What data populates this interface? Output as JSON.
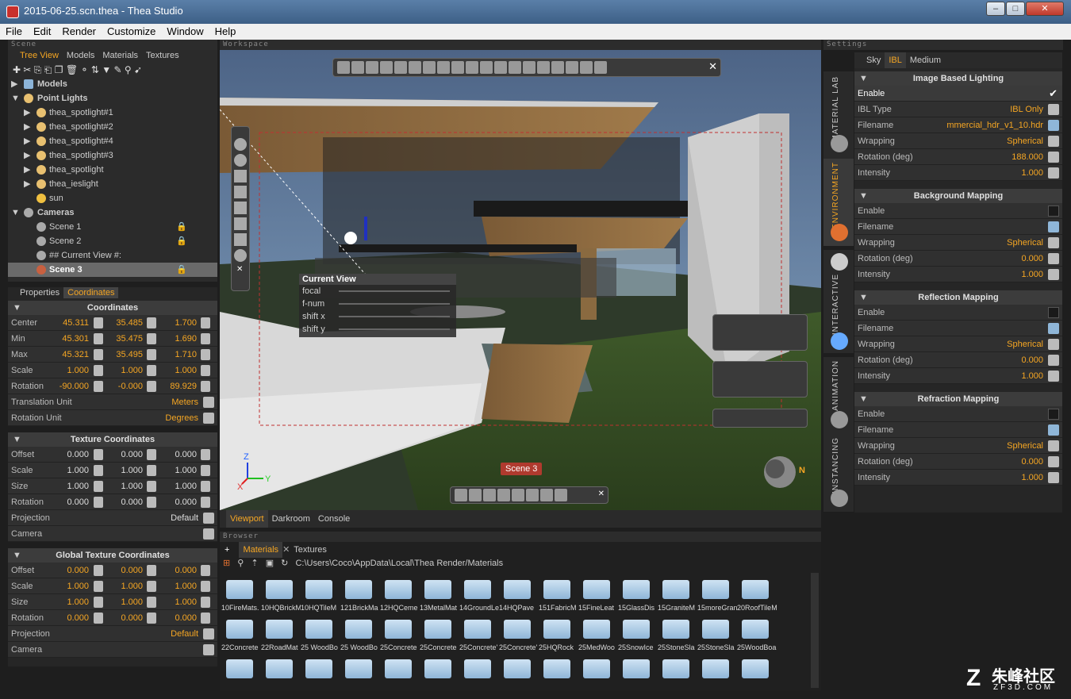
{
  "window": {
    "title": "2015-06-25.scn.thea - Thea Studio",
    "min": "–",
    "max": "□",
    "close": "✕"
  },
  "menu": [
    "File",
    "Edit",
    "Render",
    "Customize",
    "Window",
    "Help"
  ],
  "scene_panel": {
    "header": "Scene",
    "tabs": [
      "Tree View",
      "Models",
      "Materials",
      "Textures"
    ],
    "tree": {
      "models": "Models",
      "point_lights": "Point Lights",
      "lights": [
        "thea_spotlight#1",
        "thea_spotlight#2",
        "thea_spotlight#4",
        "thea_spotlight#3",
        "thea_spotlight",
        "thea_ieslight",
        "sun"
      ],
      "cameras": "Cameras",
      "camera_items": [
        "Scene 1",
        "Scene 2",
        "## Current View #:",
        "Scene 3"
      ]
    }
  },
  "props_panel": {
    "tabs": [
      "Properties",
      "Coordinates"
    ],
    "coords": {
      "title": "Coordinates",
      "rows": [
        {
          "label": "Center",
          "v": [
            "45.311",
            "35.485",
            "1.700"
          ]
        },
        {
          "label": "Min",
          "v": [
            "45.301",
            "35.475",
            "1.690"
          ]
        },
        {
          "label": "Max",
          "v": [
            "45.321",
            "35.495",
            "1.710"
          ]
        },
        {
          "label": "Scale",
          "v": [
            "1.000",
            "1.000",
            "1.000"
          ]
        },
        {
          "label": "Rotation",
          "v": [
            "-90.000",
            "-0.000",
            "89.929"
          ]
        }
      ],
      "translation_unit": {
        "label": "Translation Unit",
        "value": "Meters"
      },
      "rotation_unit": {
        "label": "Rotation Unit",
        "value": "Degrees"
      }
    },
    "texcoords": {
      "title": "Texture Coordinates",
      "rows": [
        {
          "label": "Offset",
          "v": [
            "0.000",
            "0.000",
            "0.000"
          ]
        },
        {
          "label": "Scale",
          "v": [
            "1.000",
            "1.000",
            "1.000"
          ]
        },
        {
          "label": "Size",
          "v": [
            "1.000",
            "1.000",
            "1.000"
          ]
        },
        {
          "label": "Rotation",
          "v": [
            "0.000",
            "0.000",
            "0.000"
          ]
        }
      ],
      "projection": {
        "label": "Projection",
        "value": "Default"
      },
      "camera": "Camera"
    },
    "global": {
      "title": "Global Texture Coordinates",
      "rows": [
        {
          "label": "Offset",
          "v": [
            "0.000",
            "0.000",
            "0.000"
          ]
        },
        {
          "label": "Scale",
          "v": [
            "1.000",
            "1.000",
            "1.000"
          ]
        },
        {
          "label": "Size",
          "v": [
            "1.000",
            "1.000",
            "1.000"
          ]
        },
        {
          "label": "Rotation",
          "v": [
            "0.000",
            "0.000",
            "0.000"
          ]
        }
      ],
      "projection": {
        "label": "Projection",
        "value": "Default"
      },
      "camera": "Camera"
    }
  },
  "workspace": {
    "header": "Workspace",
    "current_view": {
      "title": "Current View",
      "params": [
        "focal",
        "f-num",
        "shift x",
        "shift y"
      ]
    },
    "scene_label": "Scene 3",
    "axis": {
      "z": "Z",
      "x": "X",
      "y": "Y"
    },
    "compass": "N",
    "bottom_tabs": [
      "Viewport",
      "Darkroom",
      "Console"
    ]
  },
  "browser": {
    "header": "Browser",
    "tabs": [
      "Materials",
      "Textures"
    ],
    "path": "C:\\Users\\Coco\\AppData\\Local\\Thea Render/Materials",
    "row1": [
      "10FireMats.",
      "10HQBrickM",
      "10HQTileM",
      "121BrickMa",
      "12HQCeme",
      "13MetalMat",
      "14GroundLe",
      "14HQPave",
      "151FabricM",
      "15FineLeat",
      "15GlassDis",
      "15GraniteM",
      "15moreGran",
      "20RoofTileM"
    ],
    "row2": [
      "22Concrete",
      "22RoadMat",
      "25 WoodBo",
      "25 WoodBo",
      "25Concrete",
      "25Concrete",
      "25Concrete'",
      "25Concrete'",
      "25HQRock",
      "25MedWoo",
      "25SnowIce",
      "25StoneSla",
      "25StoneSla",
      "25WoodBoa"
    ]
  },
  "settings": {
    "header": "Settings",
    "tabs": [
      "Sky",
      "IBL",
      "Medium"
    ],
    "vtabs": [
      "MATERIAL LAB",
      "ENVIRONMENT",
      "INTERACTIVE",
      "ANIMATION",
      "INSTANCING"
    ],
    "ibl": {
      "title": "Image Based Lighting",
      "enable": "Enable",
      "type": {
        "label": "IBL Type",
        "value": "IBL Only"
      },
      "filename": {
        "label": "Filename",
        "value": "mmercial_hdr_v1_10.hdr"
      },
      "wrapping": {
        "label": "Wrapping",
        "value": "Spherical"
      },
      "rotation": {
        "label": "Rotation (deg)",
        "value": "188.000"
      },
      "intensity": {
        "label": "Intensity",
        "value": "1.000"
      }
    },
    "bg": {
      "title": "Background Mapping",
      "enable": "Enable",
      "filename": "Filename",
      "wrapping": {
        "label": "Wrapping",
        "value": "Spherical"
      },
      "rotation": {
        "label": "Rotation (deg)",
        "value": "0.000"
      },
      "intensity": {
        "label": "Intensity",
        "value": "1.000"
      }
    },
    "refl": {
      "title": "Reflection Mapping",
      "enable": "Enable",
      "filename": "Filename",
      "wrapping": {
        "label": "Wrapping",
        "value": "Spherical"
      },
      "rotation": {
        "label": "Rotation (deg)",
        "value": "0.000"
      },
      "intensity": {
        "label": "Intensity",
        "value": "1.000"
      }
    },
    "refr": {
      "title": "Refraction Mapping",
      "enable": "Enable",
      "filename": "Filename",
      "wrapping": {
        "label": "Wrapping",
        "value": "Spherical"
      },
      "rotation": {
        "label": "Rotation (deg)",
        "value": "0.000"
      },
      "intensity": {
        "label": "Intensity",
        "value": "1.000"
      }
    }
  },
  "watermark": {
    "cn": "朱峰社区",
    "en": "ZF3D.COM"
  }
}
